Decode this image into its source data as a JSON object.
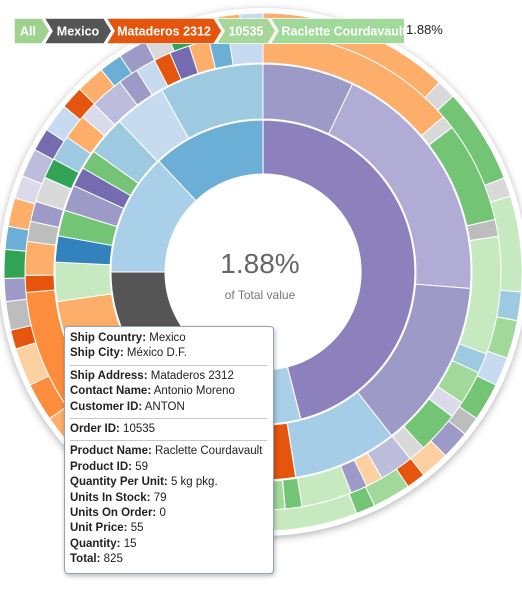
{
  "breadcrumb": {
    "items": [
      {
        "label": "All",
        "color": "#9fd28f"
      },
      {
        "label": "Mexico",
        "color": "#555555"
      },
      {
        "label": "Mataderos 2312",
        "color": "#e6550d"
      },
      {
        "label": "10535",
        "color": "#a6d69a"
      },
      {
        "label": "Raclette Courdavault",
        "color": "#a1d99b"
      }
    ],
    "value": "1.88%"
  },
  "center": {
    "value": "1.88%",
    "label": "of Total value"
  },
  "tooltip": {
    "ship_country_label": "Ship Country:",
    "ship_country": "Mexico",
    "ship_city_label": "Ship City:",
    "ship_city": "México D.F.",
    "ship_address_label": "Ship Address:",
    "ship_address": "Mataderos 2312",
    "contact_name_label": "Contact Name:",
    "contact_name": "Antonio Moreno",
    "customer_id_label": "Customer ID:",
    "customer_id": "ANTON",
    "order_id_label": "Order ID:",
    "order_id": "10535",
    "product_name_label": "Product Name:",
    "product_name": "Raclette Courdavault",
    "product_id_label": "Product ID:",
    "product_id": "59",
    "qpu_label": "Quantity Per Unit:",
    "qpu": "5 kg pkg.",
    "stock_label": "Units In Stock:",
    "stock": "79",
    "on_order_label": "Units On Order:",
    "on_order": "0",
    "price_label": "Unit Price:",
    "price": "55",
    "quantity_label": "Quantity:",
    "quantity": "15",
    "total_label": "Total:",
    "total": "825"
  },
  "chart_data": {
    "type": "sunburst",
    "value_format": "percent",
    "selected_path": [
      "Mexico",
      "Mataderos 2312",
      "10535",
      "Raclette Courdavault"
    ],
    "selected_value_percent": 1.88,
    "rings": [
      {
        "level": "Ship Country",
        "segments": [
          {
            "value": 46,
            "color": "#8c80bd"
          },
          {
            "value": 13,
            "color": "#a9d0e8"
          },
          {
            "value": 16,
            "color": "#555555"
          },
          {
            "value": 13,
            "color": "#a9d0e8"
          },
          {
            "value": 12,
            "color": "#6baed6"
          }
        ]
      },
      {
        "level": "Ship Address",
        "segments": [
          {
            "value": 7,
            "color": "#9e9ac8"
          },
          {
            "value": 19,
            "color": "#b0acd6"
          },
          {
            "value": 13,
            "color": "#9e9ac8"
          },
          {
            "value": 8,
            "color": "#a6cde8"
          },
          {
            "value": 12,
            "color": "#e6550d"
          },
          {
            "value": 7,
            "color": "#e6550d"
          },
          {
            "value": 6,
            "color": "#fdae6b"
          },
          {
            "value": 3,
            "color": "#c7e9c0"
          },
          {
            "value": 2,
            "color": "#3182bd"
          },
          {
            "value": 2,
            "color": "#74c476"
          },
          {
            "value": 2,
            "color": "#9e9ac8"
          },
          {
            "value": 1.5,
            "color": "#756bb1"
          },
          {
            "value": 1.5,
            "color": "#74c476"
          },
          {
            "value": 3,
            "color": "#9ecae1"
          },
          {
            "value": 4,
            "color": "#c6dbef"
          },
          {
            "value": 8,
            "color": "#9ecae1"
          }
        ]
      },
      {
        "level": "Order",
        "segments": [
          {
            "value": 12,
            "color": "#fdae6b"
          },
          {
            "value": 0.8,
            "color": "#d9d9d9"
          },
          {
            "value": 6,
            "color": "#74c476"
          },
          {
            "value": 1,
            "color": "#bdbdbd"
          },
          {
            "value": 7,
            "color": "#c7e9c0"
          },
          {
            "value": 1.2,
            "color": "#9ecae1"
          },
          {
            "value": 2,
            "color": "#a1d99b"
          },
          {
            "value": 1,
            "color": "#dadaeb"
          },
          {
            "value": 2.5,
            "color": "#74c476"
          },
          {
            "value": 1,
            "color": "#d9d9d9"
          },
          {
            "value": 2,
            "color": "#bcbddc"
          },
          {
            "value": 1,
            "color": "#fdd0a2"
          },
          {
            "value": 1,
            "color": "#9e9ac8"
          },
          {
            "value": 3,
            "color": "#c7e9c0"
          },
          {
            "value": 1,
            "color": "#74c476"
          },
          {
            "value": 12,
            "color": "#a1d99b"
          },
          {
            "value": 10,
            "color": "#fd8d3c"
          },
          {
            "value": 1,
            "color": "#e6550d"
          },
          {
            "value": 2,
            "color": "#fdae6b"
          },
          {
            "value": 1.2,
            "color": "#bdbdbd"
          },
          {
            "value": 1.2,
            "color": "#9e9ac8"
          },
          {
            "value": 1.5,
            "color": "#d9d9d9"
          },
          {
            "value": 1.2,
            "color": "#31a354"
          },
          {
            "value": 1.5,
            "color": "#9ecae1"
          },
          {
            "value": 1.5,
            "color": "#fdae6b"
          },
          {
            "value": 1,
            "color": "#dadaeb"
          },
          {
            "value": 2,
            "color": "#bcbddc"
          },
          {
            "value": 1.2,
            "color": "#9e9ac8"
          },
          {
            "value": 1.2,
            "color": "#c6dbef"
          },
          {
            "value": 1,
            "color": "#e6550d"
          },
          {
            "value": 1.2,
            "color": "#756bb1"
          },
          {
            "value": 1.2,
            "color": "#fdae6b"
          },
          {
            "value": 1.2,
            "color": "#6baed6"
          },
          {
            "value": 2,
            "color": "#c6dbef"
          }
        ]
      },
      {
        "level": "Product",
        "segments": [
          {
            "value": 10,
            "color": "#fdae6b"
          },
          {
            "value": 1,
            "color": "#d9d9d9"
          },
          {
            "value": 5,
            "color": "#74c476"
          },
          {
            "value": 1,
            "color": "#d9d9d9"
          },
          {
            "value": 5,
            "color": "#c7e9c0"
          },
          {
            "value": 1.5,
            "color": "#9ecae1"
          },
          {
            "value": 2,
            "color": "#a1d99b"
          },
          {
            "value": 1.5,
            "color": "#c6dbef"
          },
          {
            "value": 2,
            "color": "#74c476"
          },
          {
            "value": 1,
            "color": "#bdbdbd"
          },
          {
            "value": 1.5,
            "color": "#9e9ac8"
          },
          {
            "value": 1.5,
            "color": "#fdd0a2"
          },
          {
            "value": 1,
            "color": "#e6550d"
          },
          {
            "value": 2,
            "color": "#a1d99b"
          },
          {
            "value": 1,
            "color": "#74c476"
          },
          {
            "value": 6,
            "color": "#c7e9c0"
          },
          {
            "value": 1.88,
            "color": "#a1d99b"
          },
          {
            "value": 4,
            "color": "#c7e9c0"
          },
          {
            "value": 6,
            "color": "#fdae6b"
          },
          {
            "value": 2,
            "color": "#fd8d3c"
          },
          {
            "value": 2,
            "color": "#fdd0a2"
          },
          {
            "value": 1,
            "color": "#e6550d"
          },
          {
            "value": 1.5,
            "color": "#bdbdbd"
          },
          {
            "value": 1.2,
            "color": "#9e9ac8"
          },
          {
            "value": 1.5,
            "color": "#31a354"
          },
          {
            "value": 1.2,
            "color": "#6baed6"
          },
          {
            "value": 1.5,
            "color": "#fdae6b"
          },
          {
            "value": 1.2,
            "color": "#dadaeb"
          },
          {
            "value": 1.5,
            "color": "#bcbddc"
          },
          {
            "value": 1.2,
            "color": "#756bb1"
          },
          {
            "value": 1.5,
            "color": "#c6dbef"
          },
          {
            "value": 1.2,
            "color": "#e6550d"
          },
          {
            "value": 1.5,
            "color": "#fdae6b"
          },
          {
            "value": 1.2,
            "color": "#6baed6"
          },
          {
            "value": 1.5,
            "color": "#9e9ac8"
          },
          {
            "value": 1.2,
            "color": "#d9d9d9"
          },
          {
            "value": 1.2,
            "color": "#31a354"
          },
          {
            "value": 1.2,
            "color": "#bcbddc"
          },
          {
            "value": 1.5,
            "color": "#fdae6b"
          },
          {
            "value": 1.2,
            "color": "#c6dbef"
          }
        ]
      }
    ]
  }
}
